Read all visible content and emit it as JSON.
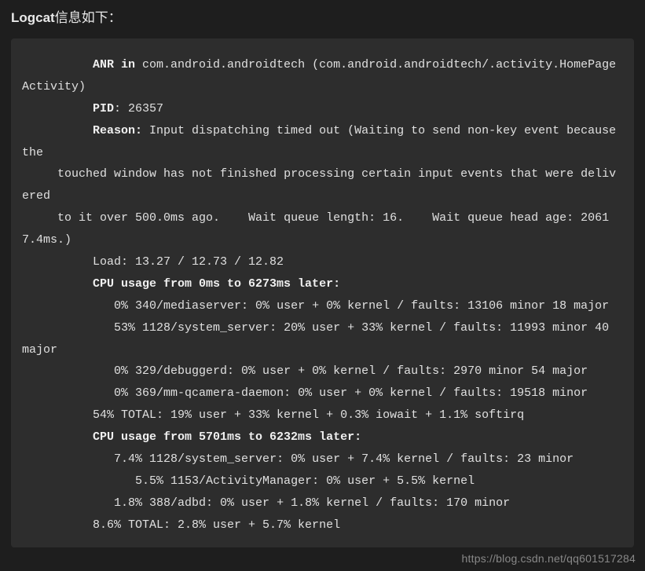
{
  "header": {
    "prefix": "Logcat",
    "suffix": "信息如下："
  },
  "log": {
    "l1a": "          ",
    "l1b": "ANR in",
    "l1c": " com.android.androidtech (com.android.androidtech/.activity.HomePageActivity)",
    "l2a": "          ",
    "l2b": "PID",
    "l2c": ": 26357",
    "l3a": "          ",
    "l3b": "Reason:",
    "l3c": " Input dispatching timed out (Waiting to send non-key event because the",
    "l4": "     touched window has not finished processing certain input events that were delivered",
    "l5": "     to it over 500.0ms ago.    Wait queue length: 16.    Wait queue head age: 20617.4ms.)",
    "l6": "          Load: 13.27 / 12.73 / 12.82",
    "l7a": "          ",
    "l7b": "CPU usage from 0ms to 6273ms later:",
    "l8": "             0% 340/mediaserver: 0% user + 0% kernel / faults: 13106 minor 18 major",
    "l9": "             53% 1128/system_server: 20% user + 33% kernel / faults: 11993 minor 40 major",
    "l10": "             0% 329/debuggerd: 0% user + 0% kernel / faults: 2970 minor 54 major",
    "l11": "             0% 369/mm-qcamera-daemon: 0% user + 0% kernel / faults: 19518 minor",
    "l12": "          54% TOTAL: 19% user + 33% kernel + 0.3% iowait + 1.1% softirq",
    "l13a": "          ",
    "l13b": "CPU usage from 5701ms to 6232ms later:",
    "l14": "             7.4% 1128/system_server: 0% user + 7.4% kernel / faults: 23 minor",
    "l15": "                5.5% 1153/ActivityManager: 0% user + 5.5% kernel",
    "l16": "             1.8% 388/adbd: 0% user + 1.8% kernel / faults: 170 minor",
    "l17": "          8.6% TOTAL: 2.8% user + 5.7% kernel"
  },
  "watermark": "https://blog.csdn.net/qq601517284"
}
